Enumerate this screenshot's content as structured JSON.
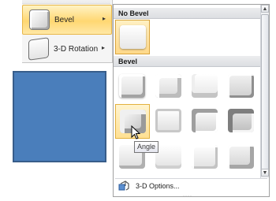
{
  "menu": {
    "items": [
      {
        "label": "Bevel",
        "has_submenu": true,
        "highlighted": true
      },
      {
        "label": "3-D Rotation",
        "has_submenu": true,
        "highlighted": false
      }
    ],
    "submenu_arrow": "▸"
  },
  "gallery": {
    "sections": [
      {
        "title": "No Bevel"
      },
      {
        "title": "Bevel"
      }
    ],
    "hovered_item": "Angle",
    "footer": {
      "label": "3-D Options...",
      "icon": "3d-options-icon"
    },
    "resize_grip": "····"
  },
  "tooltip": {
    "text": "Angle"
  },
  "scrollbar": {
    "up": "▲",
    "down": "▼"
  },
  "colors": {
    "highlight": "#ffd772",
    "shape_fill": "#4a7ebb",
    "shape_border": "#385d8a"
  }
}
